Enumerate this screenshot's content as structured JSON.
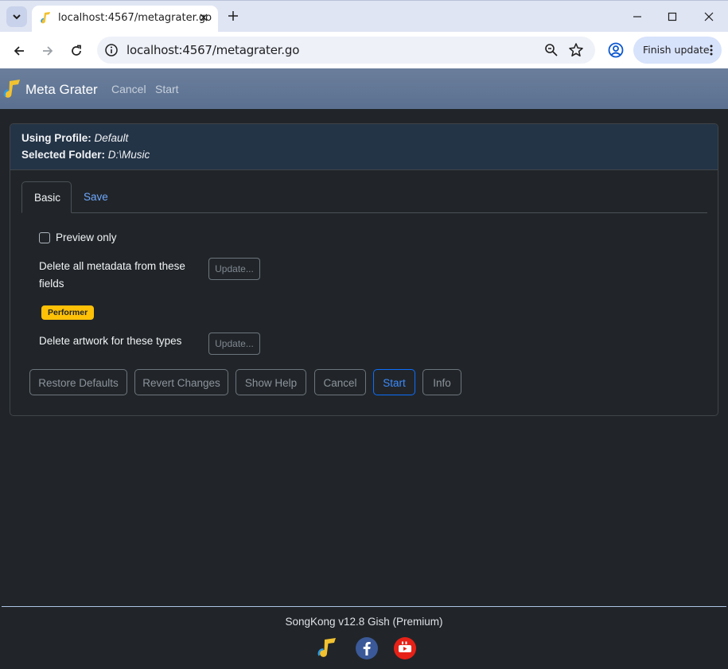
{
  "browser": {
    "tab_title": "localhost:4567/metagrater.go",
    "url": "localhost:4567/metagrater.go",
    "finish_update_label": "Finish update",
    "icons": [
      "tab-search-icon",
      "music-favicon-icon",
      "close-icon",
      "plus-icon",
      "minimize-icon",
      "maximize-icon",
      "close-window-icon",
      "back-arrow-icon",
      "forward-arrow-icon",
      "reload-icon",
      "info-icon",
      "zoom-icon",
      "star-icon",
      "profile-icon",
      "more-vert-icon"
    ]
  },
  "app": {
    "brand": "Meta Grater",
    "nav": [
      {
        "label": "Cancel"
      },
      {
        "label": "Start"
      }
    ]
  },
  "card": {
    "profile_label": "Using Profile:",
    "profile_value": "Default",
    "folder_label": "Selected Folder:",
    "folder_value": "D:\\Music",
    "tabs": [
      {
        "label": "Basic",
        "active": true
      },
      {
        "label": "Save",
        "active": false
      }
    ],
    "preview_only_label": "Preview only",
    "preview_only_checked": false,
    "delete_metadata_label_line1": "Delete all metadata from these",
    "delete_metadata_label_line2": "fields",
    "update_button_label": "Update...",
    "field_badge": "Performer",
    "delete_artwork_label": "Delete artwork for these types",
    "buttons": [
      {
        "label": "Restore Defaults"
      },
      {
        "label": "Revert Changes"
      },
      {
        "label": "Show Help"
      },
      {
        "label": "Cancel"
      },
      {
        "label": "Start"
      },
      {
        "label": "Info"
      }
    ]
  },
  "footer": {
    "text": "SongKong v12.8 Gish (Premium)",
    "links": [
      "songkong-logo-icon",
      "facebook-icon",
      "youtube-icon"
    ]
  },
  "colors": {
    "background": "#212529",
    "navbar": "#5f7493",
    "card_header": "#243447",
    "primary": "#0d6efd",
    "badge": "#ffc107",
    "link": "#6ea8fe"
  }
}
